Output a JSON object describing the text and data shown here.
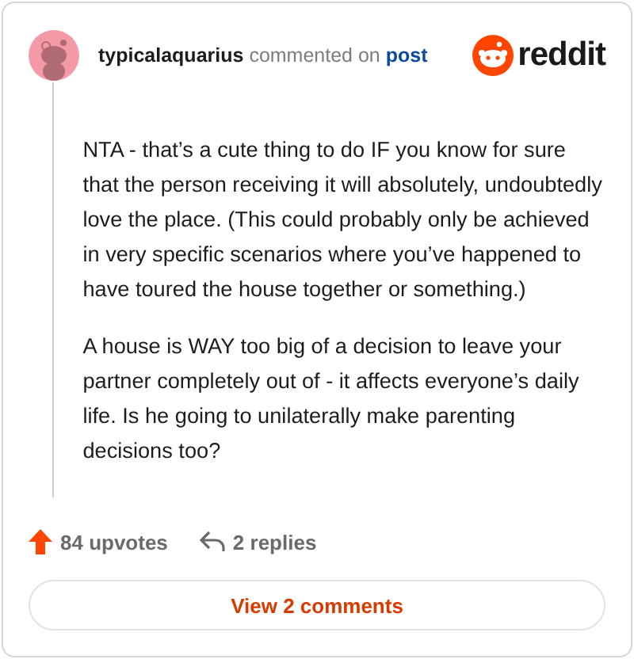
{
  "comment": {
    "author": "typicalaquarius",
    "action": "commented on",
    "link": "post"
  },
  "brand": {
    "name": "reddit"
  },
  "paragraphs": [
    "NTA - that’s a cute thing to do IF you know for sure that the person receiving it will absolutely, undoubtedly love the place. (This could probably only be achieved in very specific scenarios where you’ve happened to have toured the house together or something.)",
    "A house is WAY too big of a decision to leave your partner completely out of - it affects everyone’s daily life. Is he going to unilaterally make parenting decisions too?"
  ],
  "footer": {
    "upvotes": "84 upvotes",
    "replies": "2 replies"
  },
  "button": {
    "label": "View 2 comments"
  }
}
